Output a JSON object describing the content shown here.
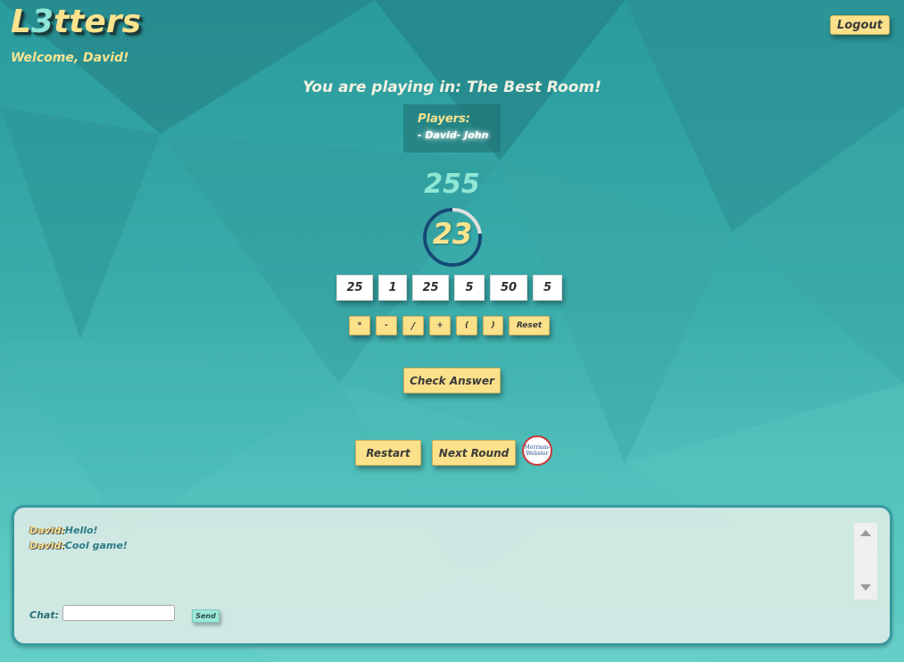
{
  "app": {
    "logo_prefix": "L",
    "logo_three": "3",
    "logo_suffix": "tters",
    "welcome": "Welcome, David!",
    "logout_label": "Logout"
  },
  "room": {
    "title": "You are playing in: The Best Room!",
    "players_label": "Players:",
    "players_list": "- David- John"
  },
  "game": {
    "target": "255",
    "timer_value": "23",
    "timer_fraction_remaining": 0.77,
    "numbers": [
      "25",
      "1",
      "25",
      "5",
      "50",
      "5"
    ],
    "operators": [
      "*",
      "-",
      "/",
      "+",
      "(",
      ")"
    ],
    "reset_label": "Reset",
    "check_label": "Check Answer",
    "restart_label": "Restart",
    "next_round_label": "Next Round",
    "dictionary_logo_line1": "Merriam-",
    "dictionary_logo_line2": "Webster"
  },
  "chat": {
    "messages": [
      {
        "author": "David:",
        "text": "Hello!"
      },
      {
        "author": "David:",
        "text": "Cool game!"
      }
    ],
    "label": "Chat:",
    "input_value": "",
    "send_label": "Send"
  },
  "colors": {
    "accent_yellow": "#fbe18a",
    "accent_mint": "#8ee6d4",
    "timer_ring": "#114a73",
    "timer_track": "#e0e0e0"
  }
}
